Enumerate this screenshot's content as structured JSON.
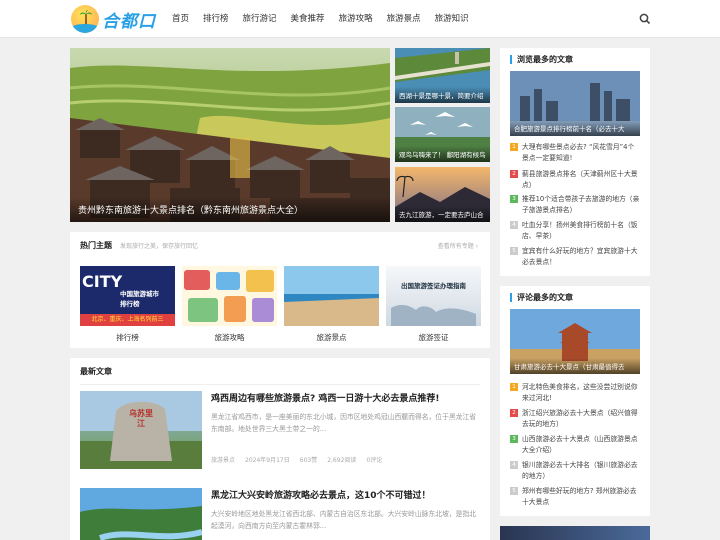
{
  "brand": {
    "logo_text": "合都口"
  },
  "nav": {
    "items": [
      "首页",
      "排行榜",
      "旅行游记",
      "美食推荐",
      "旅游攻略",
      "旅游景点",
      "旅游知识"
    ]
  },
  "featured": {
    "main_caption": "贵州黔东南旅游十大景点排名（黔东南州旅游景点大全）",
    "side": [
      "西湖十景是哪十景，简要介绍",
      "观鸟乌嗨来了！ 鄱阳湖有候鸟",
      "去九江旅游，一定要去庐山合"
    ]
  },
  "hot_topics": {
    "title": "热门主题",
    "subtitle": "发现旅行之美，保存旅行回忆",
    "more": "查看所有专题 ›",
    "items": [
      {
        "label": "排行榜",
        "overlay": [
          "CITY",
          "中国旅游城市",
          "排行榜",
          "北京、重庆、上海名列前三"
        ]
      },
      {
        "label": "旅游攻略",
        "overlay": []
      },
      {
        "label": "旅游景点",
        "overlay": []
      },
      {
        "label": "旅游签证",
        "overlay": [
          "出国旅游签证办理指南"
        ]
      }
    ]
  },
  "latest": {
    "title": "最新文章",
    "posts": [
      {
        "title": "鸡西周边有哪些旅游景点? 鸡西一日游十大必去景点推荐!",
        "excerpt": "黑龙江省鸡西市，是一座美丽的东北小城，因市区地处鸡冠山西麓而得名，位于黑龙江省东南部。地处世界三大黑土带之一的...",
        "category": "旅游景点",
        "date": "2024年9月17日",
        "likes": "603赞",
        "views": "2,692阅读",
        "comments": "0评论",
        "stone_text": "乌苏里江"
      },
      {
        "title": "黑龙江大兴安岭旅游攻略必去景点，这10个不可错过！",
        "excerpt": "大兴安岭地区地处黑龙江省西北部、内蒙古自治区东北部。大兴安岭山脉东北坡，是指北起漠河，向西南方向至内蒙古霍林郭...",
        "category": "",
        "date": "",
        "likes": "",
        "views": "",
        "comments": ""
      }
    ]
  },
  "sidebar": {
    "most_viewed": {
      "title": "浏览最多的文章",
      "image_caption": "合肥旅游景点排行榜前十名（必去十大",
      "items": [
        "大理有哪些景点必去? “风花雪月”4个景点一定要知道!",
        "蓟县旅游景点排名（天津蓟州区十大景点）",
        "推荐10个适合带孩子去旅游的地方（亲子旅游景点排名）",
        "吐血分享！扬州美食排行榜前十名（饭店、早茶）",
        "宜宾有什么好玩的地方？宜宾旅游十大必去景点！"
      ]
    },
    "most_commented": {
      "title": "评论最多的文章",
      "image_caption": "甘肃旅游必去十大景点（甘肃最值得去",
      "items": [
        "河北特色美食排名，这些没尝过别说你来过河北!",
        "浙江绍兴旅游必去十大景点（绍兴值得去玩的地方）",
        "山西旅游必去十大景点（山西旅游景点大全介绍）",
        "银川旅游必去十大排名（银川旅游必去的地方）",
        "郑州有哪些好玩的地方? 郑州旅游必去十大景点"
      ]
    }
  },
  "colors": {
    "accent": "#2aa0e6",
    "rank1": "#f5a623",
    "rank2": "#e34b4b",
    "rank3": "#5cb85c"
  }
}
